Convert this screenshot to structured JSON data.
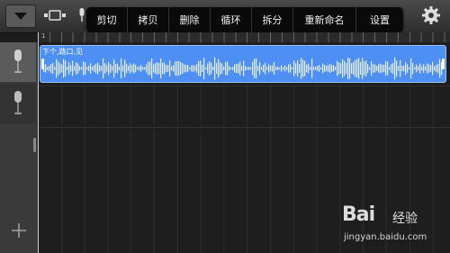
{
  "context_menu": {
    "items": [
      {
        "label": "剪切"
      },
      {
        "label": "拷贝"
      },
      {
        "label": "删除"
      },
      {
        "label": "循环"
      },
      {
        "label": "拆分"
      },
      {
        "label": "重新命名"
      },
      {
        "label": "设置"
      }
    ]
  },
  "ruler": {
    "bar_label": "1"
  },
  "region": {
    "name": "下个,路口,见",
    "color": "#4d8ff2"
  },
  "icons": {
    "menu": "triangle-down-icon",
    "view": "track-view-icon",
    "mic": "microphone-icon",
    "settings": "gear-icon",
    "add": "plus-icon"
  },
  "watermark": {
    "logo_text": "Bai",
    "logo_suffix": "经验",
    "url": "jingyan.baidu.com"
  }
}
